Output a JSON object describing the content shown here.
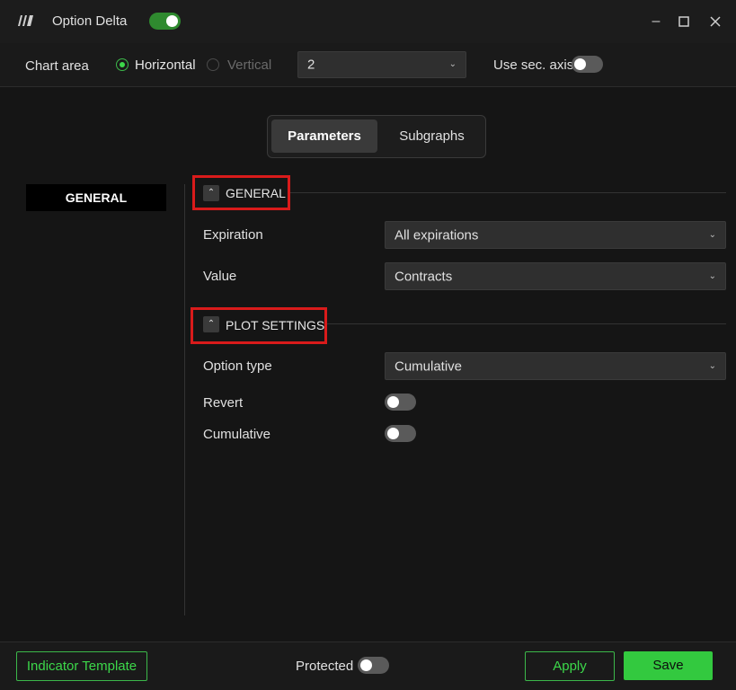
{
  "window": {
    "title": "Option Delta",
    "enabled": true
  },
  "topbar": {
    "chart_area_label": "Chart area",
    "orientation_options": [
      {
        "label": "Horizontal",
        "selected": true
      },
      {
        "label": "Vertical",
        "selected": false,
        "disabled": true
      }
    ],
    "pane_select_value": "2",
    "sec_axis_label": "Use sec. axis",
    "sec_axis_on": false
  },
  "tabs": [
    {
      "label": "Parameters",
      "active": true
    },
    {
      "label": "Subgraphs",
      "active": false
    }
  ],
  "nav": {
    "general": "GENERAL"
  },
  "sections": {
    "general": {
      "title": "GENERAL",
      "rows": [
        {
          "label": "Expiration",
          "value": "All expirations"
        },
        {
          "label": "Value",
          "value": "Contracts"
        }
      ]
    },
    "plot": {
      "title": "PLOT SETTINGS",
      "option_type_label": "Option type",
      "option_type_value": "Cumulative",
      "revert_label": "Revert",
      "revert_on": false,
      "cumulative_label": "Cumulative",
      "cumulative_on": false
    }
  },
  "footer": {
    "template_label": "Indicator Template",
    "protected_label": "Protected",
    "protected_on": false,
    "apply_label": "Apply",
    "save_label": "Save"
  },
  "colors": {
    "accent": "#3cd84a",
    "highlight": "#d91b1b",
    "background": "#151515"
  },
  "icons": {
    "logo": "app-logo-icon",
    "minimize": "minimize-icon",
    "maximize": "maximize-icon",
    "close": "close-icon",
    "chevron": "chevron-down-icon",
    "collapse": "chevron-up-icon"
  }
}
